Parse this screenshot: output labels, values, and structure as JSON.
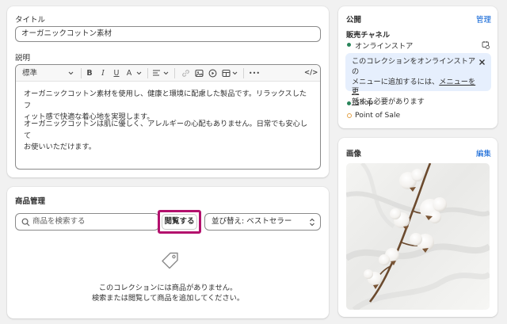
{
  "details": {
    "title_label": "タイトル",
    "title_value": "オーガニックコットン素材",
    "description_label": "説明",
    "toolbar": {
      "format_label": "標準",
      "bold": "B",
      "italic": "I",
      "underline": "U",
      "text_color": "A",
      "more": "•••",
      "code": "</>"
    },
    "paragraph_1_line_1": "オーガニックコットン素材を使用し、健康と環境に配慮した製品です。リラックスしたフ",
    "paragraph_1_line_2": "ィット感で快適な着心地を実現します。",
    "paragraph_2_line_1": "オーガニックコットンは肌に優しく、アレルギーの心配もありません。日常でも安心して",
    "paragraph_2_line_2": "お使いいただけます。"
  },
  "products": {
    "heading": "商品管理",
    "search_placeholder": "商品を検索する",
    "browse_label": "閲覧する",
    "sort_label": "並び替え: ベストセラー",
    "empty_line_1": "このコレクションには商品がありません。",
    "empty_line_2": "検索または閲覧して商品を追加してください。"
  },
  "publishing": {
    "heading": "公開",
    "manage_link": "管理",
    "channels_label": "販売チャネル",
    "online_store": "オンラインストア",
    "banner_line_1": "このコレクションをオンラインストアの",
    "banner_line_2_prefix": "メニューに追加するには、",
    "banner_link": "メニューを更",
    "banner_line_3_link": "新",
    "banner_line_3_suffix": "する必要があります",
    "shop": "Shop",
    "point_of_sale": "Point of Sale"
  },
  "image": {
    "heading": "画像",
    "edit_link": "編集"
  },
  "colors": {
    "accent_link": "#005bd3",
    "active_dot": "#29845a",
    "inactive_dot": "#e3a147",
    "highlight_border": "#b3106d",
    "banner_bg": "#e6effd"
  }
}
